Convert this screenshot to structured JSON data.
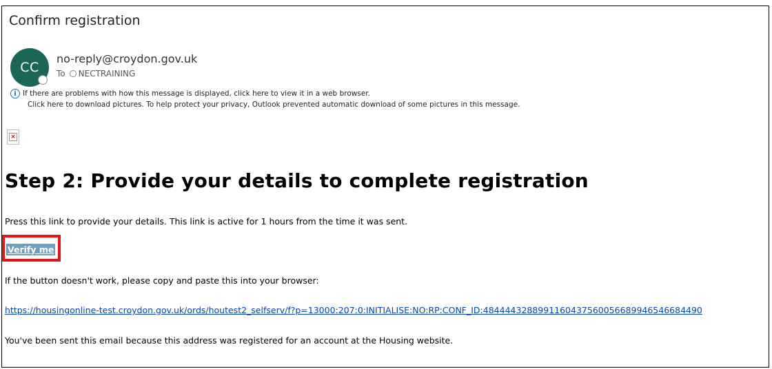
{
  "email": {
    "subject": "Confirm registration",
    "avatar_initials": "CC",
    "sender": "no-reply@croydon.gov.uk",
    "to_label": "To",
    "recipient": "NECTRAINING",
    "info_line_1": "If there are problems with how this message is displayed, click here to view it in a web browser.",
    "info_line_2": "Click here to download pictures. To help protect your privacy, Outlook prevented automatic download of some pictures in this message."
  },
  "body": {
    "heading": "Step 2: Provide your details to complete registration",
    "intro": "Press this link to provide your details. This link is active for 1 hours from the time it was sent.",
    "verify_label": "Verify me",
    "fallback_text": "If the button doesn't work, please copy and paste this into your browser:",
    "link_url": "https://housingonline-test.croydon.gov.uk/ords/houtest2_selfserv/f?p=13000:207:0:INITIALISE:NO:RP:CONF_ID:48444432889911604375600566899465466844​90",
    "footer_text": "You've been sent this email because this address was registered for an account at the Housing website."
  },
  "colors": {
    "avatar": "#1c6657",
    "highlight_box": "#e3151a",
    "verify_button": "#6f9fbf",
    "link": "#0645ad"
  }
}
